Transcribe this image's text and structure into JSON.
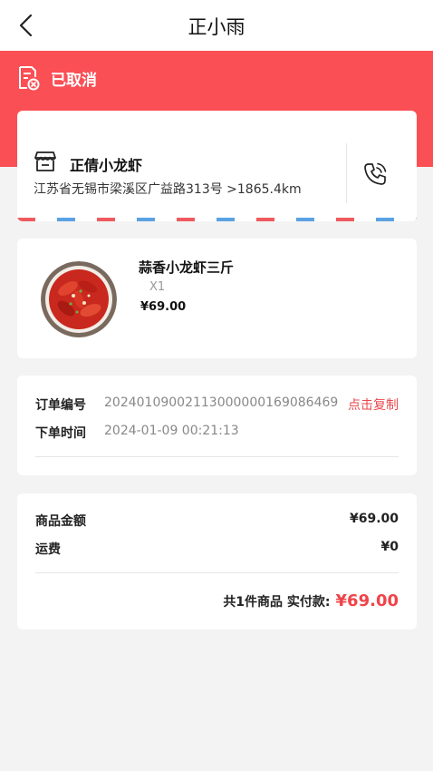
{
  "header": {
    "title": "正小雨"
  },
  "status": {
    "text": "已取消",
    "color": "#fa4f55"
  },
  "shop": {
    "name": "正倩小龙虾",
    "address": "江苏省无锡市梁溪区广益路313号 >1865.4km"
  },
  "product": {
    "name": "蒜香小龙虾三斤",
    "qty": "X1",
    "price": "¥69.00"
  },
  "order": {
    "number_label": "订单编号",
    "number_value": "20240109002113000000169086469",
    "copy_label": "点击复制",
    "time_label": "下单时间",
    "time_value": "2024-01-09 00:21:13"
  },
  "summary": {
    "goods_label": "商品金额",
    "goods_value": "¥69.00",
    "shipping_label": "运费",
    "shipping_value": "¥0",
    "total_label": "共1件商品  实付款:",
    "total_value": "¥69.00"
  }
}
